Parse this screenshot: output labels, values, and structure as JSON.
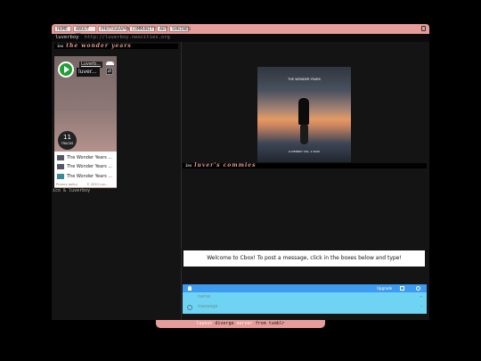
{
  "nav": {
    "items": [
      "HOME",
      "ABOUT ME",
      "PHOTOGRAPHY",
      "COMMUNITY",
      "ART",
      "SHRINES"
    ]
  },
  "header": {
    "site_name": "luverboy",
    "url": "http://luverboy.neocities.org"
  },
  "sections": {
    "wonder_years": {
      "num": "ins",
      "title": "the wonder years"
    },
    "commies": {
      "num": "ins",
      "title": "luver's commies"
    }
  },
  "player": {
    "artist": "Luverb...",
    "track": "luver...",
    "track_count": "11",
    "tracks_label": "TRACKS",
    "tracks": [
      "The Wonder Years ...",
      "The Wonder Years ...",
      "The Wonder Years ..."
    ],
    "privacy": "Privacy policy",
    "copyright": "© 2020 Luv..."
  },
  "credit": "ico & luverboy",
  "photo": {
    "caption": "THE WONDER YEARS",
    "subcaption": "LUVERBOY VOL. 2 2020"
  },
  "cbox": {
    "welcome": "Welcome to Cbox! To post a message, click in the boxes below and type!",
    "upgrade": "Upgrade",
    "name_placeholder": "name",
    "message_placeholder": "message"
  },
  "footer": {
    "layout_word": "layout",
    "layout_name": "diverge",
    "by_word": "server",
    "from_word": "from",
    "source": "tumblr"
  },
  "colors": {
    "accent": "#e69c98",
    "background": "#141414",
    "cbox_bar": "#3d9bf2",
    "cbox_form": "#6fd4f3"
  }
}
